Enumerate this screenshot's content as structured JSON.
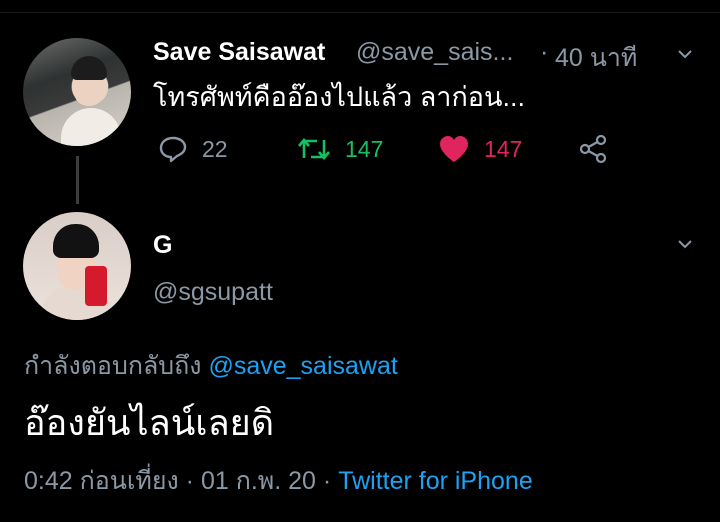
{
  "parent_tweet": {
    "display_name": "Save Saisawat",
    "handle": "@save_sais...",
    "separator": "·",
    "time": "40 นาที",
    "text": "โทรศัพท์คืออ๊องไปแล้ว ลาก่อน...",
    "stats": {
      "replies": "22",
      "retweets": "147",
      "likes": "147"
    }
  },
  "reply_tweet": {
    "display_name": "G",
    "handle": "@sgsupatt",
    "replying_to_label": "กำลังตอบกลับถึง",
    "replying_to_handle": "@save_saisawat",
    "text": "อ๊องยันไลน์เลยดิ",
    "timestamp": "0:42 ก่อนเที่ยง · 01 ก.พ. 20 ·",
    "source": "Twitter for iPhone"
  },
  "icons": {
    "reply": "speech-bubble-icon",
    "retweet": "retweet-arrows-icon",
    "like": "heart-icon",
    "share": "share-icon",
    "menu": "chevron-down-icon"
  },
  "colors": {
    "background": "#000000",
    "secondary_text": "#8b98a5",
    "retweet_green": "#17bf63",
    "like_red": "#e0245e",
    "link_blue": "#1da1f2"
  }
}
